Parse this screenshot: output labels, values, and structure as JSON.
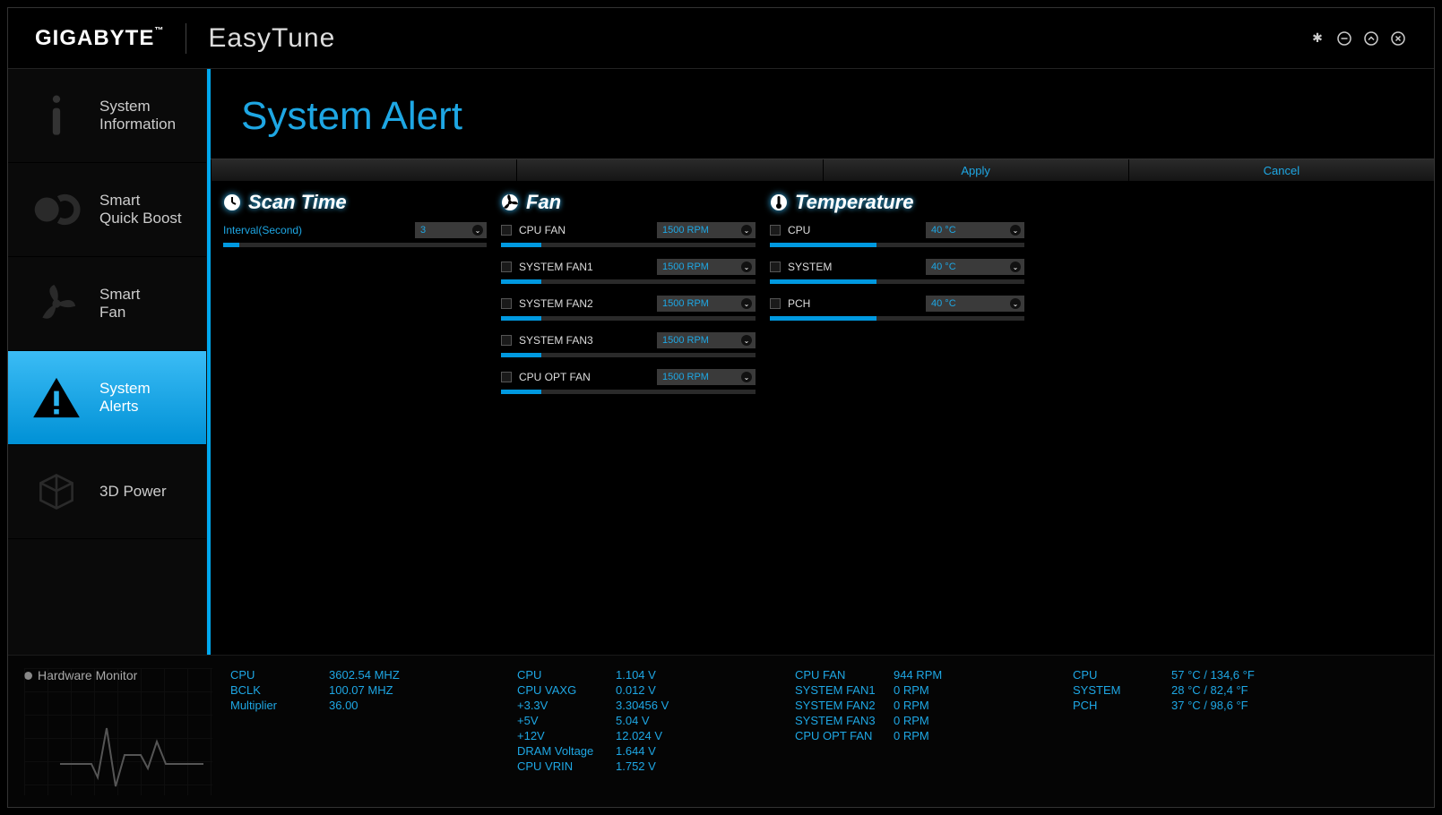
{
  "header": {
    "brand": "GIGABYTE",
    "tm": "™",
    "app": "EasyTune"
  },
  "sidebar": [
    {
      "id": "sysinfo",
      "label": "System\nInformation"
    },
    {
      "id": "quickboost",
      "label": "Smart\nQuick Boost"
    },
    {
      "id": "smartfan",
      "label": "Smart\nFan"
    },
    {
      "id": "alerts",
      "label": "System\nAlerts",
      "active": true
    },
    {
      "id": "3dpower",
      "label": "3D Power"
    }
  ],
  "page": {
    "title": "System Alert"
  },
  "actions": {
    "apply": "Apply",
    "cancel": "Cancel"
  },
  "scan": {
    "head": "Scan Time",
    "interval_label": "Interval(Second)",
    "interval_value": "3",
    "fill": 6
  },
  "fan": {
    "head": "Fan",
    "items": [
      {
        "label": "CPU FAN",
        "value": "1500 RPM",
        "fill": 16
      },
      {
        "label": "SYSTEM FAN1",
        "value": "1500 RPM",
        "fill": 16
      },
      {
        "label": "SYSTEM FAN2",
        "value": "1500 RPM",
        "fill": 16
      },
      {
        "label": "SYSTEM FAN3",
        "value": "1500 RPM",
        "fill": 16
      },
      {
        "label": "CPU OPT FAN",
        "value": "1500 RPM",
        "fill": 16
      }
    ]
  },
  "temp": {
    "head": "Temperature",
    "items": [
      {
        "label": "CPU",
        "value": "40 °C",
        "fill": 42
      },
      {
        "label": "SYSTEM",
        "value": "40 °C",
        "fill": 42
      },
      {
        "label": "PCH",
        "value": "40 °C",
        "fill": 42
      }
    ]
  },
  "hwmon": {
    "title": "Hardware Monitor"
  },
  "stats": {
    "c1": [
      {
        "k": "CPU",
        "v": "3602.54 MHZ"
      },
      {
        "k": "BCLK",
        "v": "100.07 MHZ"
      },
      {
        "k": "Multiplier",
        "v": "36.00"
      }
    ],
    "c2": [
      {
        "k": "CPU",
        "v": "1.104 V"
      },
      {
        "k": "CPU VAXG",
        "v": "0.012 V"
      },
      {
        "k": "+3.3V",
        "v": "3.30456 V"
      },
      {
        "k": "+5V",
        "v": "5.04 V"
      },
      {
        "k": "+12V",
        "v": "12.024 V"
      },
      {
        "k": "DRAM Voltage",
        "v": "1.644 V"
      },
      {
        "k": "CPU VRIN",
        "v": "1.752 V"
      }
    ],
    "c3": [
      {
        "k": "CPU FAN",
        "v": "944 RPM"
      },
      {
        "k": "SYSTEM FAN1",
        "v": "0 RPM"
      },
      {
        "k": "SYSTEM FAN2",
        "v": "0 RPM"
      },
      {
        "k": "SYSTEM FAN3",
        "v": "0 RPM"
      },
      {
        "k": "CPU OPT FAN",
        "v": "0 RPM"
      }
    ],
    "c4": [
      {
        "k": "CPU",
        "v": "57 °C / 134,6 °F"
      },
      {
        "k": "SYSTEM",
        "v": "28 °C / 82,4 °F"
      },
      {
        "k": "PCH",
        "v": "37 °C / 98,6 °F"
      }
    ]
  }
}
